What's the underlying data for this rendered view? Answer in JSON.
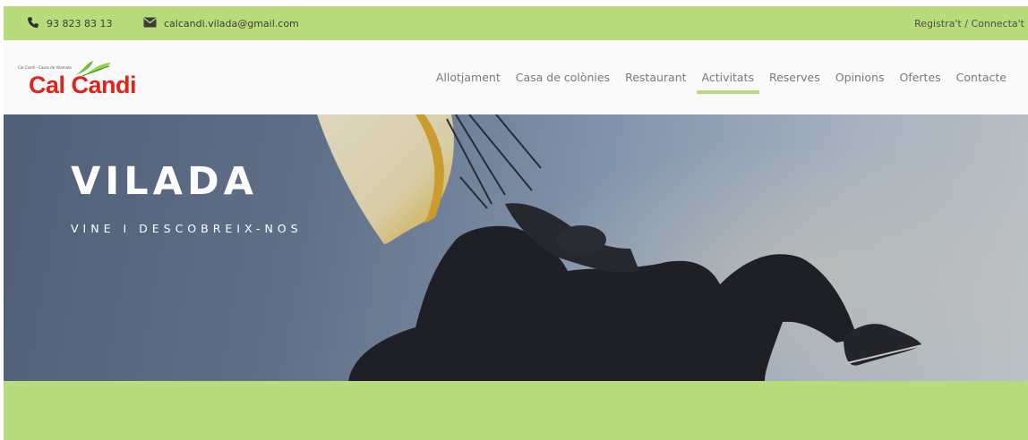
{
  "topbar": {
    "phone": "93 823 83 13",
    "phone_icon": "phone-icon",
    "email": "calcandi.vilada@gmail.com",
    "email_icon": "envelope-icon",
    "login_link": "Registra't / Connecta't"
  },
  "header": {
    "logo_small": "Cal Candi - Cases de Vilamala",
    "logo_text": "Cal Candi",
    "nav": [
      {
        "label": "Allotjament"
      },
      {
        "label": "Casa de colònies"
      },
      {
        "label": "Restaurant"
      },
      {
        "label": "Activitats",
        "active": true
      },
      {
        "label": "Reserves"
      },
      {
        "label": "Opinions"
      },
      {
        "label": "Ofertes"
      },
      {
        "label": "Contacte"
      }
    ]
  },
  "hero": {
    "title": "VILADA",
    "subtitle": "VINE I DESCOBREIX-NOS"
  },
  "colors": {
    "accent_green": "#b8dc7c",
    "logo_red": "#e2231a",
    "nav_text": "#7a7a7a"
  }
}
